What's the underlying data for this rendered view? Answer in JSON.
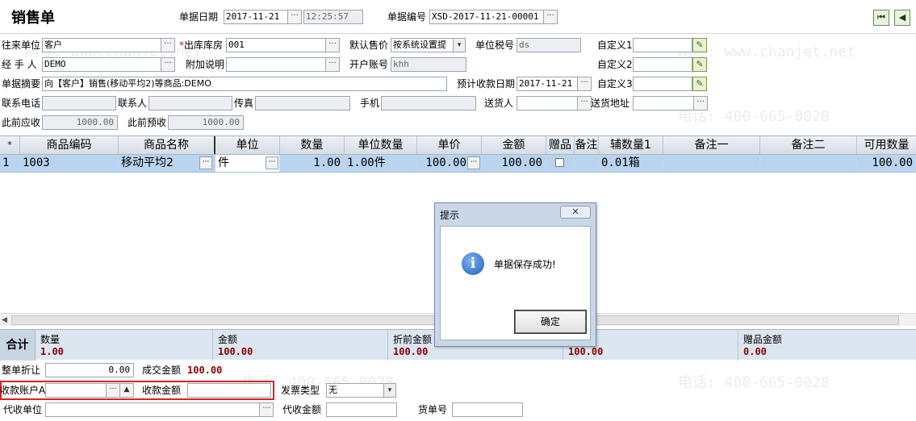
{
  "watermark": {
    "phone": "电话: 400-665-0028",
    "site": "网址: www.chanjet.net"
  },
  "window": {
    "title": "销售单"
  },
  "header": {
    "date_label": "单据日期",
    "date_value": "2017-11-21",
    "time_value": "12:25:57",
    "doc_no_label": "单据编号",
    "doc_no_value": "XSD-2017-11-21-00001"
  },
  "form": {
    "customer_label": "往来单位",
    "customer_value": "客户",
    "warehouse_label": "*出库库房",
    "warehouse_value": "001",
    "price_label": "默认售价",
    "price_value": "按系统设置提",
    "tax_label": "单位税号",
    "tax_value": "ds",
    "custom1_label": "自定义1",
    "handler_label": "经 手 人",
    "handler_value": "DEMO",
    "note_label": "附加说明",
    "note_value": "",
    "account_label": "开户账号",
    "account_value": "khh",
    "custom2_label": "自定义2",
    "summary_label": "单据摘要",
    "summary_value": "向【客户】销售(移动平均2)等商品:DEMO",
    "due_label": "预计收款日期",
    "due_value": "2017-11-21",
    "custom3_label": "自定义3",
    "phone_label": "联系电话",
    "contact_label": "联系人",
    "fax_label": "传真",
    "mobile_label": "手机",
    "deliver_label": "送货人",
    "address_label": "送货地址",
    "prev_recv_label": "此前应收",
    "prev_recv_value": "1000.00",
    "prev_prepay_label": "此前预收",
    "prev_prepay_value": "1000.00"
  },
  "grid": {
    "columns": [
      "*",
      "商品编码",
      "商品名称",
      "单位",
      "数量",
      "单位数量",
      "单价",
      "金额",
      "赠品",
      "备注",
      "辅数量1",
      "备注一",
      "备注二",
      "可用数量"
    ],
    "rows": [
      {
        "idx": "1",
        "code": "1003",
        "name": "移动平均2",
        "unit": "件",
        "qty": "1.00",
        "unit_qty": "1.00件",
        "price": "100.00",
        "amount": "100.00",
        "aux_qty": "0.01箱",
        "available": "100.00"
      }
    ]
  },
  "totals": {
    "label": "合计",
    "qty_label": "数量",
    "qty_value": "1.00",
    "amount_label": "金额",
    "amount_value": "100.00",
    "pre_discount_label": "折前金额",
    "pre_discount_value": "100.00",
    "tax_amount_label": "金额",
    "tax_amount_value": "100.00",
    "gift_label": "赠品金额",
    "gift_value": "0.00"
  },
  "footer": {
    "discount_label": "整单折让",
    "discount_value": "0.00",
    "deal_label": "成交金额",
    "deal_value": "100.00",
    "recv_account_label": "收款账户A",
    "recv_amount_label": "收款金额",
    "invoice_label": "发票类型",
    "invoice_value": "无",
    "agent_unit_label": "代收单位",
    "agent_amount_label": "代收金额",
    "waybill_label": "货单号"
  },
  "dialog": {
    "title": "提示",
    "message": "单据保存成功!",
    "ok_label": "确定",
    "close_glyph": "✕"
  }
}
